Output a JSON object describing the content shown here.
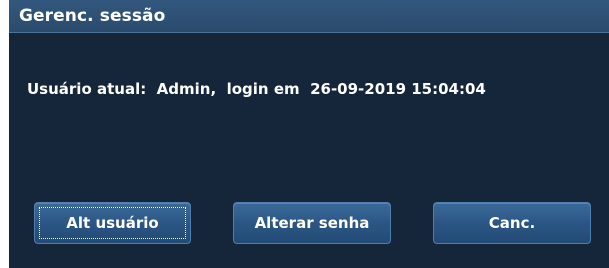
{
  "dialog": {
    "title": "Gerenc. sessão",
    "session_info": "Usuário atual:  Admin,  login em  26-09-2019 15:04:04"
  },
  "buttons": {
    "switch_user": "Alt usuário",
    "change_password": "Alterar senha",
    "cancel": "Canc."
  },
  "colors": {
    "dialog_background": "#16263a",
    "title_bar": "#2e5174",
    "button": "#2a5583",
    "text": "#ffffff"
  }
}
